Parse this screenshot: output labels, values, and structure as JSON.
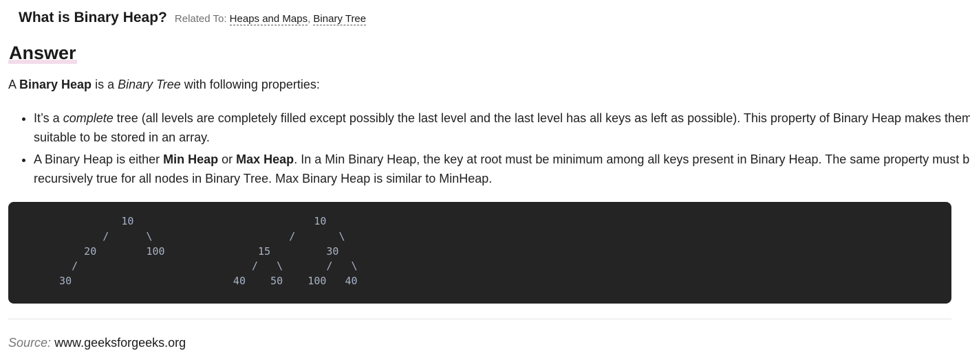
{
  "question": {
    "title": "What is Binary Heap?",
    "related_prefix": "Related To:",
    "related_tags": [
      "Heaps and Maps",
      "Binary Tree"
    ],
    "separator": ", "
  },
  "answer": {
    "heading": "Answer",
    "intro": {
      "p1": "A ",
      "bold1": "Binary Heap",
      "p2": " is a ",
      "italic1": "Binary Tree",
      "p3": " with following properties:"
    },
    "bullets": [
      {
        "p1": "It’s a ",
        "italic": "complete",
        "p2": " tree (all levels are completely filled except possibly the last level and the last level has all keys as left as possible). This property of Binary Heap makes them suitable to be stored in an array."
      },
      {
        "p1": "A Binary Heap is either ",
        "bold1": "Min Heap",
        "p2": " or ",
        "bold2": "Max Heap",
        "p3": ". In a Min Binary Heap, the key at root must be minimum among all keys present in Binary Heap. The same property must be recursively true for all nodes in Binary Tree. Max Binary Heap is similar to MinHeap."
      }
    ],
    "code": "            10                             10\n         /      \\                      /       \\\n      20        100               15         30\n    /                            /   \\       /   \\\n  30                          40    50    100   40"
  },
  "source": {
    "label": "Source:",
    "link": "www.geeksforgeeks.org"
  }
}
